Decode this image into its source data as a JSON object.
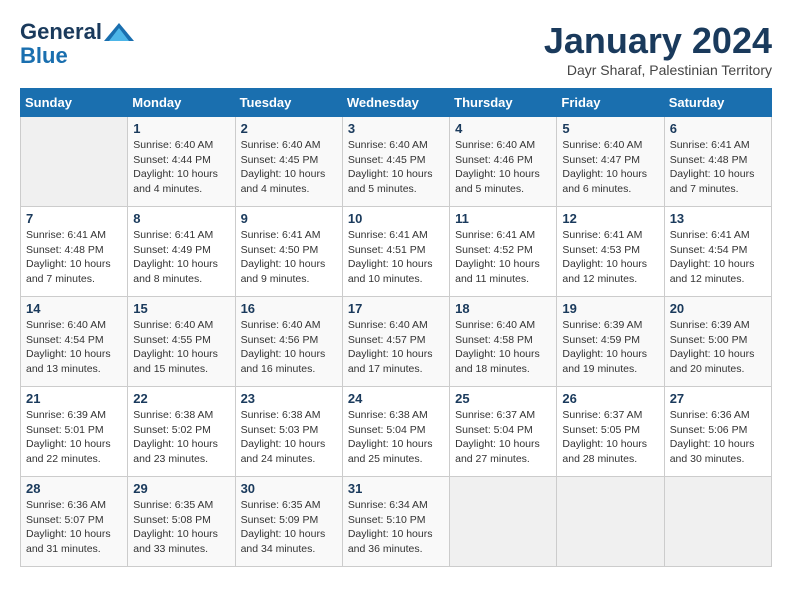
{
  "header": {
    "logo_general": "General",
    "logo_blue": "Blue",
    "title": "January 2024",
    "subtitle": "Dayr Sharaf, Palestinian Territory"
  },
  "days_of_week": [
    "Sunday",
    "Monday",
    "Tuesday",
    "Wednesday",
    "Thursday",
    "Friday",
    "Saturday"
  ],
  "weeks": [
    [
      {
        "day": "",
        "info": ""
      },
      {
        "day": "1",
        "info": "Sunrise: 6:40 AM\nSunset: 4:44 PM\nDaylight: 10 hours\nand 4 minutes."
      },
      {
        "day": "2",
        "info": "Sunrise: 6:40 AM\nSunset: 4:45 PM\nDaylight: 10 hours\nand 4 minutes."
      },
      {
        "day": "3",
        "info": "Sunrise: 6:40 AM\nSunset: 4:45 PM\nDaylight: 10 hours\nand 5 minutes."
      },
      {
        "day": "4",
        "info": "Sunrise: 6:40 AM\nSunset: 4:46 PM\nDaylight: 10 hours\nand 5 minutes."
      },
      {
        "day": "5",
        "info": "Sunrise: 6:40 AM\nSunset: 4:47 PM\nDaylight: 10 hours\nand 6 minutes."
      },
      {
        "day": "6",
        "info": "Sunrise: 6:41 AM\nSunset: 4:48 PM\nDaylight: 10 hours\nand 7 minutes."
      }
    ],
    [
      {
        "day": "7",
        "info": "Sunrise: 6:41 AM\nSunset: 4:48 PM\nDaylight: 10 hours\nand 7 minutes."
      },
      {
        "day": "8",
        "info": "Sunrise: 6:41 AM\nSunset: 4:49 PM\nDaylight: 10 hours\nand 8 minutes."
      },
      {
        "day": "9",
        "info": "Sunrise: 6:41 AM\nSunset: 4:50 PM\nDaylight: 10 hours\nand 9 minutes."
      },
      {
        "day": "10",
        "info": "Sunrise: 6:41 AM\nSunset: 4:51 PM\nDaylight: 10 hours\nand 10 minutes."
      },
      {
        "day": "11",
        "info": "Sunrise: 6:41 AM\nSunset: 4:52 PM\nDaylight: 10 hours\nand 11 minutes."
      },
      {
        "day": "12",
        "info": "Sunrise: 6:41 AM\nSunset: 4:53 PM\nDaylight: 10 hours\nand 12 minutes."
      },
      {
        "day": "13",
        "info": "Sunrise: 6:41 AM\nSunset: 4:54 PM\nDaylight: 10 hours\nand 12 minutes."
      }
    ],
    [
      {
        "day": "14",
        "info": "Sunrise: 6:40 AM\nSunset: 4:54 PM\nDaylight: 10 hours\nand 13 minutes."
      },
      {
        "day": "15",
        "info": "Sunrise: 6:40 AM\nSunset: 4:55 PM\nDaylight: 10 hours\nand 15 minutes."
      },
      {
        "day": "16",
        "info": "Sunrise: 6:40 AM\nSunset: 4:56 PM\nDaylight: 10 hours\nand 16 minutes."
      },
      {
        "day": "17",
        "info": "Sunrise: 6:40 AM\nSunset: 4:57 PM\nDaylight: 10 hours\nand 17 minutes."
      },
      {
        "day": "18",
        "info": "Sunrise: 6:40 AM\nSunset: 4:58 PM\nDaylight: 10 hours\nand 18 minutes."
      },
      {
        "day": "19",
        "info": "Sunrise: 6:39 AM\nSunset: 4:59 PM\nDaylight: 10 hours\nand 19 minutes."
      },
      {
        "day": "20",
        "info": "Sunrise: 6:39 AM\nSunset: 5:00 PM\nDaylight: 10 hours\nand 20 minutes."
      }
    ],
    [
      {
        "day": "21",
        "info": "Sunrise: 6:39 AM\nSunset: 5:01 PM\nDaylight: 10 hours\nand 22 minutes."
      },
      {
        "day": "22",
        "info": "Sunrise: 6:38 AM\nSunset: 5:02 PM\nDaylight: 10 hours\nand 23 minutes."
      },
      {
        "day": "23",
        "info": "Sunrise: 6:38 AM\nSunset: 5:03 PM\nDaylight: 10 hours\nand 24 minutes."
      },
      {
        "day": "24",
        "info": "Sunrise: 6:38 AM\nSunset: 5:04 PM\nDaylight: 10 hours\nand 25 minutes."
      },
      {
        "day": "25",
        "info": "Sunrise: 6:37 AM\nSunset: 5:04 PM\nDaylight: 10 hours\nand 27 minutes."
      },
      {
        "day": "26",
        "info": "Sunrise: 6:37 AM\nSunset: 5:05 PM\nDaylight: 10 hours\nand 28 minutes."
      },
      {
        "day": "27",
        "info": "Sunrise: 6:36 AM\nSunset: 5:06 PM\nDaylight: 10 hours\nand 30 minutes."
      }
    ],
    [
      {
        "day": "28",
        "info": "Sunrise: 6:36 AM\nSunset: 5:07 PM\nDaylight: 10 hours\nand 31 minutes."
      },
      {
        "day": "29",
        "info": "Sunrise: 6:35 AM\nSunset: 5:08 PM\nDaylight: 10 hours\nand 33 minutes."
      },
      {
        "day": "30",
        "info": "Sunrise: 6:35 AM\nSunset: 5:09 PM\nDaylight: 10 hours\nand 34 minutes."
      },
      {
        "day": "31",
        "info": "Sunrise: 6:34 AM\nSunset: 5:10 PM\nDaylight: 10 hours\nand 36 minutes."
      },
      {
        "day": "",
        "info": ""
      },
      {
        "day": "",
        "info": ""
      },
      {
        "day": "",
        "info": ""
      }
    ]
  ]
}
